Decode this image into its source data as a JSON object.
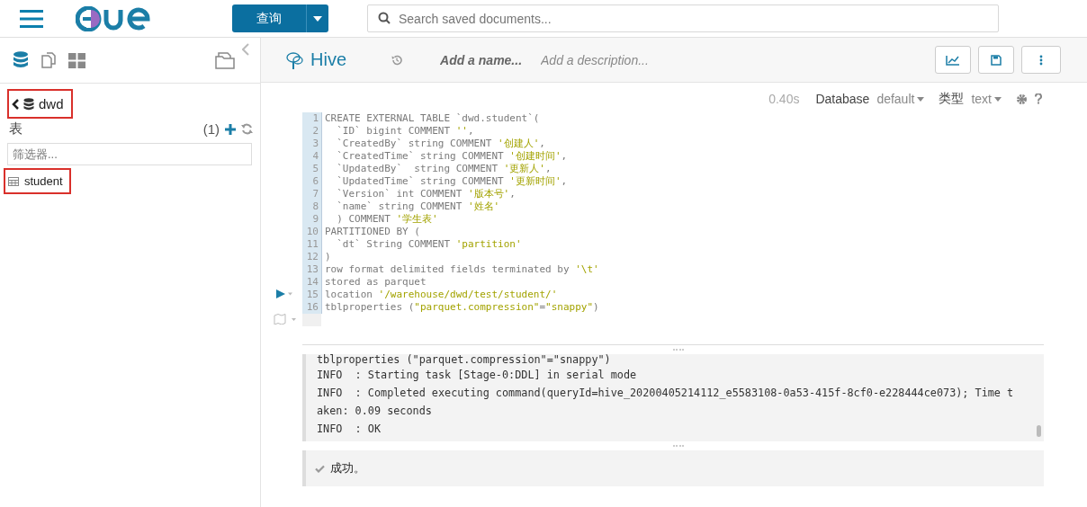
{
  "top_bar": {
    "query_button": "查询",
    "search": {
      "placeholder": "Search saved documents..."
    }
  },
  "sidebar": {
    "database": {
      "name": "dwd",
      "highlighted": true
    },
    "section_label": "表",
    "count": "(1)",
    "filter": {
      "placeholder": "筛选器..."
    },
    "tables": [
      {
        "name": "student",
        "highlighted": true
      }
    ]
  },
  "editor": {
    "engine": "Hive",
    "name_placeholder": "Add a name...",
    "description_placeholder": "Add a description...",
    "timing": "0.40s",
    "database_label": "Database",
    "database_value": "default",
    "type_label": "类型",
    "type_value": "text",
    "code_lines": [
      {
        "number": "1",
        "segments": [
          {
            "kind": "plain",
            "text": "CREATE EXTERNAL TABLE `dwd.student`("
          }
        ]
      },
      {
        "number": "2",
        "segments": [
          {
            "kind": "plain",
            "text": "  `ID` bigint COMMENT "
          },
          {
            "kind": "string",
            "text": "''"
          },
          {
            "kind": "plain",
            "text": ","
          }
        ]
      },
      {
        "number": "3",
        "segments": [
          {
            "kind": "plain",
            "text": "  `CreatedBy` string COMMENT "
          },
          {
            "kind": "string",
            "text": "'创建人'"
          },
          {
            "kind": "plain",
            "text": ","
          }
        ]
      },
      {
        "number": "4",
        "segments": [
          {
            "kind": "plain",
            "text": "  `CreatedTime` string COMMENT "
          },
          {
            "kind": "string",
            "text": "'创建时间'"
          },
          {
            "kind": "plain",
            "text": ","
          }
        ]
      },
      {
        "number": "5",
        "segments": [
          {
            "kind": "plain",
            "text": "  `UpdatedBy`  string COMMENT "
          },
          {
            "kind": "string",
            "text": "'更新人'"
          },
          {
            "kind": "plain",
            "text": ","
          }
        ]
      },
      {
        "number": "6",
        "segments": [
          {
            "kind": "plain",
            "text": "  `UpdatedTime` string COMMENT "
          },
          {
            "kind": "string",
            "text": "'更新时间'"
          },
          {
            "kind": "plain",
            "text": ","
          }
        ]
      },
      {
        "number": "7",
        "segments": [
          {
            "kind": "plain",
            "text": "  `Version` int COMMENT "
          },
          {
            "kind": "string",
            "text": "'版本号'"
          },
          {
            "kind": "plain",
            "text": ","
          }
        ]
      },
      {
        "number": "8",
        "segments": [
          {
            "kind": "plain",
            "text": "  `name` string COMMENT "
          },
          {
            "kind": "string",
            "text": "'姓名'"
          }
        ]
      },
      {
        "number": "9",
        "segments": [
          {
            "kind": "plain",
            "text": "  ) COMMENT "
          },
          {
            "kind": "string",
            "text": "'学生表'"
          }
        ]
      },
      {
        "number": "10",
        "segments": [
          {
            "kind": "plain",
            "text": "PARTITIONED BY ("
          }
        ]
      },
      {
        "number": "11",
        "segments": [
          {
            "kind": "plain",
            "text": "  `dt` String COMMENT "
          },
          {
            "kind": "string",
            "text": "'partition'"
          }
        ]
      },
      {
        "number": "12",
        "segments": [
          {
            "kind": "plain",
            "text": ")"
          }
        ]
      },
      {
        "number": "13",
        "segments": [
          {
            "kind": "plain",
            "text": "row format delimited fields terminated by "
          },
          {
            "kind": "string",
            "text": "'\\t'"
          }
        ]
      },
      {
        "number": "14",
        "segments": [
          {
            "kind": "plain",
            "text": "stored as parquet"
          }
        ]
      },
      {
        "number": "15",
        "segments": [
          {
            "kind": "plain",
            "text": "location "
          },
          {
            "kind": "string",
            "text": "'/warehouse/dwd/test/student/'"
          }
        ]
      },
      {
        "number": "16",
        "segments": [
          {
            "kind": "plain",
            "text": "tblproperties ("
          },
          {
            "kind": "string",
            "text": "\"parquet.compression\""
          },
          {
            "kind": "plain",
            "text": "="
          },
          {
            "kind": "string",
            "text": "\"snappy\""
          },
          {
            "kind": "plain",
            "text": ")"
          }
        ]
      }
    ]
  },
  "log_lines": [
    "tblproperties (\"parquet.compression\"=\"snappy\")",
    "INFO  : Starting task [Stage-0:DDL] in serial mode",
    "INFO  : Completed executing command(queryId=hive_20200405214112_e5583108-0a53-415f-8cf0-e228444ce073); Time t",
    "aken: 0.09 seconds",
    "INFO  : OK"
  ],
  "result": {
    "message": "成功。"
  }
}
